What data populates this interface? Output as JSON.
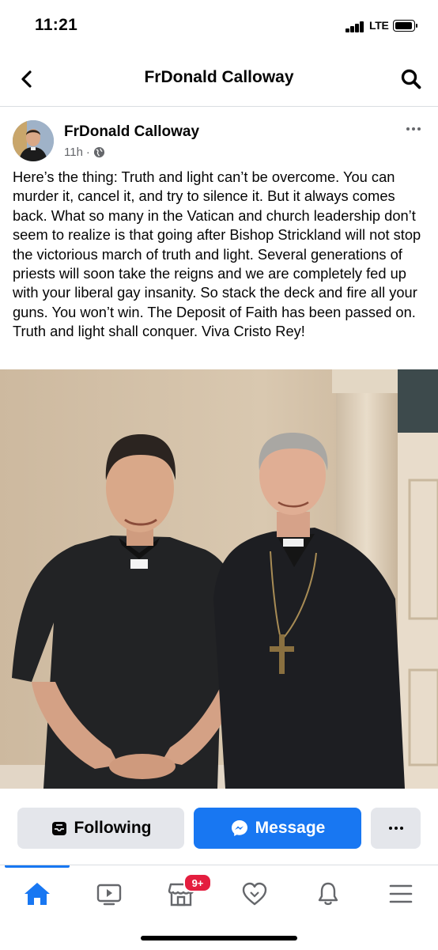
{
  "status_bar": {
    "time": "11:21",
    "network": "LTE",
    "icons": [
      "signal-icon",
      "battery-icon"
    ]
  },
  "header": {
    "title": "FrDonald Calloway",
    "back_icon": "chevron-left-icon",
    "search_icon": "search-icon"
  },
  "post": {
    "author": "FrDonald Calloway",
    "time_ago": "11h",
    "separator": "·",
    "audience_icon": "globe-icon",
    "more_icon": "more-dots-icon",
    "text": "Here’s the thing: Truth and light can’t be overcome.  You can murder it, cancel it, and try to silence it.  But it always comes back. What so many in the Vatican and church leadership don’t seem to realize is that going after Bishop Strickland will not stop the victorious march of truth and light. Several generations of priests will soon take the reigns and we are completely fed up with your liberal gay insanity.  So stack the deck and fire all your guns. You won’t win. The Deposit of Faith has been passed on. Truth and light shall conquer. Viva Cristo Rey!"
  },
  "actions": {
    "following_label": "Following",
    "message_label": "Message",
    "following_icon": "following-inbox-icon",
    "message_icon": "messenger-icon",
    "more_icon": "more-dots-icon"
  },
  "tabbar": {
    "tabs": [
      {
        "icon": "home-icon",
        "active": true
      },
      {
        "icon": "video-icon",
        "active": false
      },
      {
        "icon": "marketplace-icon",
        "active": false,
        "badge": "9+"
      },
      {
        "icon": "dating-heart-icon",
        "active": false
      },
      {
        "icon": "bell-icon",
        "active": false
      },
      {
        "icon": "menu-icon",
        "active": false
      }
    ]
  },
  "colors": {
    "accent": "#1877f2",
    "badge": "#e41e3f",
    "secondary_button": "#e4e6eb",
    "muted_text": "#65676b"
  }
}
